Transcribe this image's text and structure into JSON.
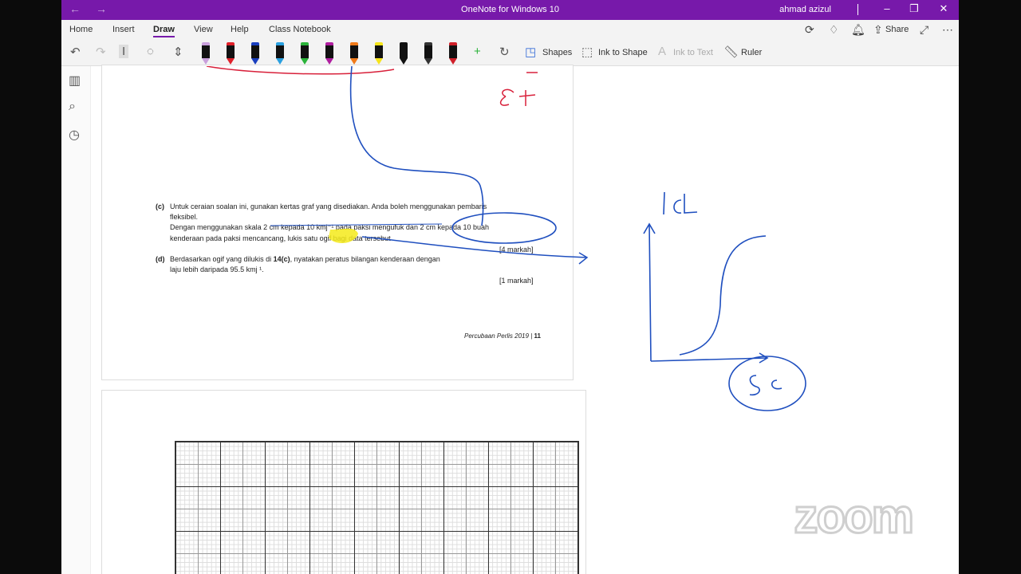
{
  "window": {
    "title": "OneNote for Windows 10",
    "user": "ahmad azizul"
  },
  "ribbon": {
    "tabs": [
      "Home",
      "Insert",
      "Draw",
      "View",
      "Help",
      "Class Notebook"
    ],
    "active_tab": "Draw",
    "share_label": "Share"
  },
  "toolbar": {
    "shapes_label": "Shapes",
    "ink_to_shape_label": "Ink to Shape",
    "ink_to_text_label": "Ink to Text",
    "ruler_label": "Ruler",
    "pen_colors": [
      "#c9a0dc",
      "#e0202a",
      "#1a3fbf",
      "#2aa0e0",
      "#2bb33a",
      "#b01ea0",
      "#f07a1a",
      "#f6e41a",
      "#111111",
      "#333333",
      "#d0202a"
    ]
  },
  "document": {
    "q_c_label": "(c)",
    "q_c_line1": "Untuk ceraian soalan ini, gunakan kertas graf yang disediakan. Anda boleh menggunakan pembaris",
    "q_c_line2": "fleksibel.",
    "q_c_line3": "Dengan menggunakan skala 2 cm kepada 10 kmj⁻¹ pada paksi mengufuk dan 2 cm kepada 10 buah",
    "q_c_line4": "kenderaan pada paksi mencancang, lukis satu ogif bagi data tersebut",
    "q_c_marks": "[4 markah]",
    "q_d_label": "(d)",
    "q_d_line1_pre": "Berdasarkan ogif yang dilukis di ",
    "q_d_line1_bold": "14(c)",
    "q_d_line1_post": ", nyatakan peratus bilangan kenderaan dengan",
    "q_d_line2": "laju lebih daripada 95.5 kmj ¹.",
    "q_d_marks": "[1 markah]",
    "footer_text": "Percubaan Perlis 2019",
    "footer_page": "11"
  },
  "watermark": "zoom"
}
